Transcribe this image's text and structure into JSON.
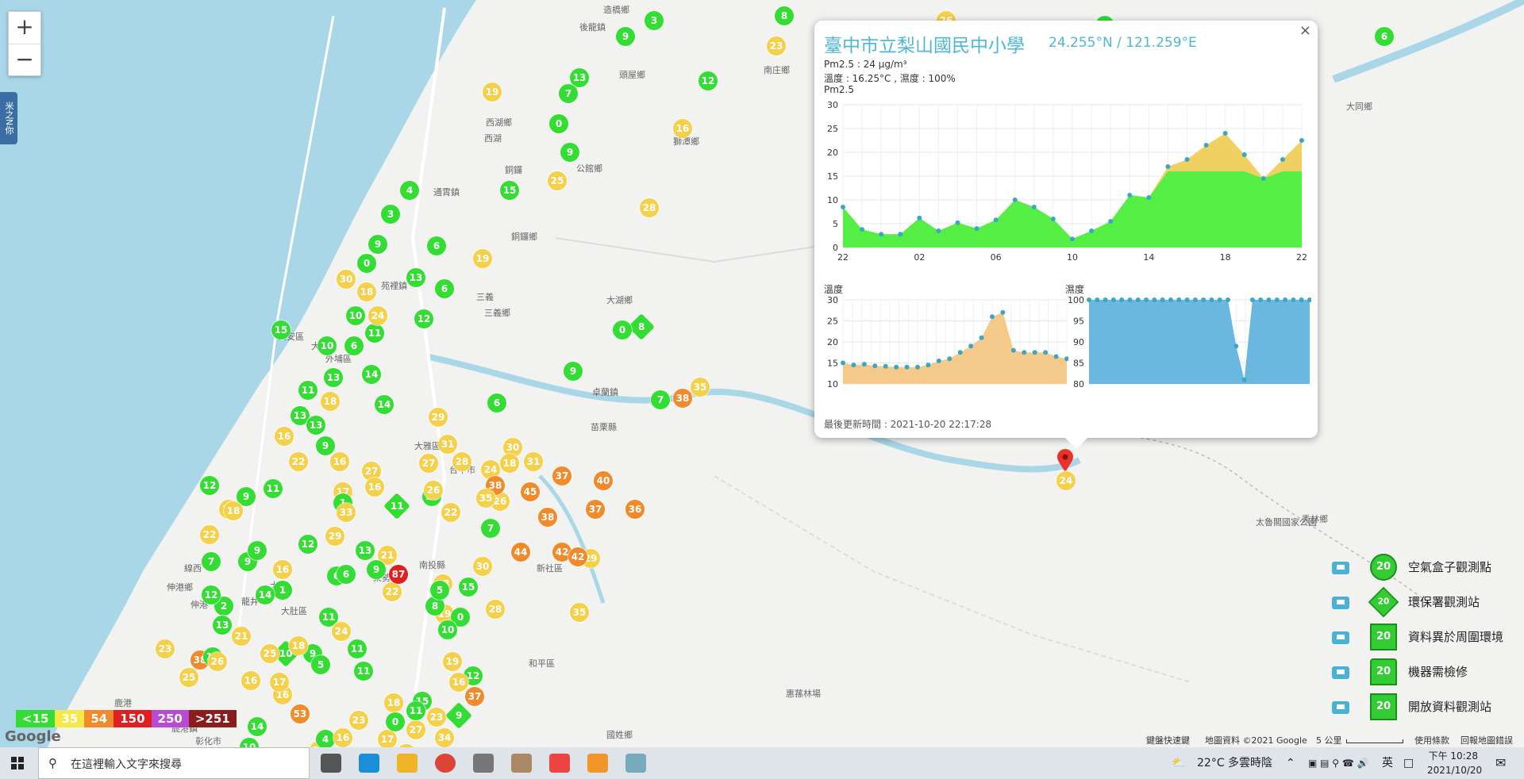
{
  "map": {
    "zoom_in": "+",
    "zoom_out": "−",
    "side_tab": "米之N你",
    "google_logo": "Google",
    "footer": {
      "shortcuts": "鍵盤快速鍵",
      "map_data": "地圖資料 ©2021 Google",
      "scale": "5 公里",
      "terms": "使用條款",
      "report": "回報地圖錯誤"
    },
    "place_labels": [
      "後龍鎮",
      "造橋鄉",
      "西湖鄉",
      "西湖",
      "頭屋鄉",
      "南庄鄉",
      "獅潭鄉",
      "公館鄉",
      "通霄鎮",
      "銅鑼",
      "銅鑼鄉",
      "苑裡鎮",
      "三義",
      "三義鄉",
      "大湖鄉",
      "大安區",
      "大甲區",
      "外埔區",
      "卓蘭鎮",
      "苗栗縣",
      "大同鄉",
      "大雅區",
      "台中市",
      "南投縣",
      "和平區",
      "伸港鄉",
      "線西",
      "伸港",
      "鹿港",
      "彰化市",
      "鹿港鎮",
      "秀林鄉",
      "太魯閣國家公園",
      "惠蓀林場",
      "國姓鄉",
      "新社區",
      "東勢",
      "大肚",
      "大肚區",
      "龍井"
    ],
    "markers": [
      {
        "v": "6",
        "c": "#33dd33"
      },
      {
        "v": "8",
        "c": "#33dd33"
      },
      {
        "v": "30",
        "c": "#f5d04a"
      },
      {
        "v": "14",
        "c": "#33dd33"
      },
      {
        "v": "12",
        "c": "#33dd33"
      },
      {
        "v": "6",
        "c": "#33dd33"
      },
      {
        "v": "23",
        "c": "#f5d04a"
      },
      {
        "v": "13",
        "c": "#33dd33"
      },
      {
        "v": "7",
        "c": "#33dd33"
      },
      {
        "v": "19",
        "c": "#f5d04a"
      },
      {
        "v": "12",
        "c": "#33dd33"
      },
      {
        "v": "0",
        "c": "#33dd33"
      },
      {
        "v": "16",
        "c": "#f5d04a"
      },
      {
        "v": "9",
        "c": "#33dd33"
      },
      {
        "v": "25",
        "c": "#f5d04a"
      },
      {
        "v": "15",
        "c": "#33dd33"
      },
      {
        "v": "28",
        "c": "#f5d04a"
      },
      {
        "v": "4",
        "c": "#33dd33"
      },
      {
        "v": "3",
        "c": "#33dd33"
      },
      {
        "v": "9",
        "c": "#33dd33"
      },
      {
        "v": "6",
        "c": "#33dd33"
      },
      {
        "v": "19",
        "c": "#f5d04a"
      },
      {
        "v": "0",
        "c": "#33dd33"
      },
      {
        "v": "13",
        "c": "#33dd33"
      },
      {
        "v": "6",
        "c": "#33dd33"
      },
      {
        "v": "30",
        "c": "#f5d04a"
      },
      {
        "v": "10",
        "c": "#33dd33"
      },
      {
        "v": "18",
        "c": "#f5d04a"
      },
      {
        "v": "11",
        "c": "#33dd33"
      },
      {
        "v": "24",
        "c": "#f5d04a"
      },
      {
        "v": "12",
        "c": "#33dd33"
      },
      {
        "v": "0",
        "c": "#33dd33"
      },
      {
        "v": "6",
        "c": "#33dd33"
      },
      {
        "v": "8",
        "c": "#33dd33",
        "d": true
      },
      {
        "v": "0",
        "c": "#33dd33"
      },
      {
        "v": "15",
        "c": "#33dd33"
      },
      {
        "v": "10",
        "c": "#33dd33"
      },
      {
        "v": "13",
        "c": "#33dd33"
      },
      {
        "v": "18",
        "c": "#f5d04a"
      },
      {
        "v": "14",
        "c": "#33dd33"
      },
      {
        "v": "11",
        "c": "#33dd33"
      },
      {
        "v": "6",
        "c": "#33dd33"
      },
      {
        "v": "14",
        "c": "#33dd33"
      },
      {
        "v": "35",
        "c": "#f5d04a"
      },
      {
        "v": "38",
        "c": "#f08a2a"
      },
      {
        "v": "7",
        "c": "#33dd33"
      },
      {
        "v": "9",
        "c": "#33dd33"
      },
      {
        "v": "7",
        "c": "#33dd33"
      },
      {
        "v": "13",
        "c": "#33dd33"
      },
      {
        "v": "16",
        "c": "#f5d04a"
      },
      {
        "v": "22",
        "c": "#f5d04a"
      },
      {
        "v": "27",
        "c": "#f5d04a"
      },
      {
        "v": "30",
        "c": "#f5d04a"
      },
      {
        "v": "26",
        "c": "#f5d04a"
      },
      {
        "v": "11",
        "c": "#33dd33"
      },
      {
        "v": "28",
        "c": "#f5d04a"
      },
      {
        "v": "29",
        "c": "#f5d04a"
      },
      {
        "v": "31",
        "c": "#f5d04a"
      },
      {
        "v": "24",
        "c": "#f5d04a"
      },
      {
        "v": "31",
        "c": "#f5d04a"
      },
      {
        "v": "37",
        "c": "#f08a2a"
      },
      {
        "v": "38",
        "c": "#f08a2a"
      },
      {
        "v": "37",
        "c": "#f08a2a"
      },
      {
        "v": "38",
        "c": "#f08a2a"
      },
      {
        "v": "45",
        "c": "#f08a2a"
      },
      {
        "v": "40",
        "c": "#f08a2a"
      },
      {
        "v": "36",
        "c": "#f08a2a"
      },
      {
        "v": "18",
        "c": "#f5d04a"
      },
      {
        "v": "42",
        "c": "#f08a2a"
      },
      {
        "v": "44",
        "c": "#f08a2a"
      },
      {
        "v": "29",
        "c": "#f5d04a"
      },
      {
        "v": "42",
        "c": "#f08a2a"
      },
      {
        "v": "30",
        "c": "#f5d04a"
      },
      {
        "v": "28",
        "c": "#f5d04a"
      },
      {
        "v": "35",
        "c": "#f5d04a"
      },
      {
        "v": "13",
        "c": "#33dd33"
      },
      {
        "v": "9",
        "c": "#33dd33"
      },
      {
        "v": "16",
        "c": "#f5d04a"
      },
      {
        "v": "17",
        "c": "#f5d04a"
      },
      {
        "v": "27",
        "c": "#f5d04a"
      },
      {
        "v": "16",
        "c": "#f5d04a"
      },
      {
        "v": "26",
        "c": "#f5d04a"
      },
      {
        "v": "11",
        "c": "#33dd33",
        "d": true
      },
      {
        "v": "35",
        "c": "#f5d04a"
      },
      {
        "v": "22",
        "c": "#f5d04a"
      },
      {
        "v": "12",
        "c": "#33dd33"
      },
      {
        "v": "11",
        "c": "#33dd33"
      },
      {
        "v": "9",
        "c": "#33dd33"
      },
      {
        "v": "16",
        "c": "#f5d04a"
      },
      {
        "v": "22",
        "c": "#f5d04a"
      },
      {
        "v": "7",
        "c": "#33dd33"
      },
      {
        "v": "9",
        "c": "#33dd33"
      },
      {
        "v": "18",
        "c": "#f5d04a"
      },
      {
        "v": "1",
        "c": "#33dd33"
      },
      {
        "v": "33",
        "c": "#f5d04a"
      },
      {
        "v": "29",
        "c": "#f5d04a"
      },
      {
        "v": "9",
        "c": "#33dd33"
      },
      {
        "v": "16",
        "c": "#f5d04a"
      },
      {
        "v": "1",
        "c": "#33dd33"
      },
      {
        "v": "2",
        "c": "#33dd33"
      },
      {
        "v": "14",
        "c": "#33dd33"
      },
      {
        "v": "13",
        "c": "#33dd33"
      },
      {
        "v": "21",
        "c": "#f5d04a"
      },
      {
        "v": "6",
        "c": "#33dd33"
      },
      {
        "v": "22",
        "c": "#f5d04a"
      },
      {
        "v": "9",
        "c": "#33dd33"
      },
      {
        "v": "87",
        "c": "#e02020"
      },
      {
        "v": "18",
        "c": "#f5d04a"
      },
      {
        "v": "19",
        "c": "#f5d04a"
      },
      {
        "v": "8",
        "c": "#33dd33"
      },
      {
        "v": "5",
        "c": "#33dd33"
      },
      {
        "v": "15",
        "c": "#33dd33"
      },
      {
        "v": "0",
        "c": "#33dd33"
      },
      {
        "v": "10",
        "c": "#33dd33"
      },
      {
        "v": "23",
        "c": "#f5d04a"
      },
      {
        "v": "38",
        "c": "#f08a2a"
      },
      {
        "v": "25",
        "c": "#f5d04a"
      },
      {
        "v": "12",
        "c": "#33dd33"
      },
      {
        "v": "16",
        "c": "#f5d04a"
      },
      {
        "v": "10",
        "c": "#33dd33",
        "d": true
      },
      {
        "v": "9",
        "c": "#33dd33"
      },
      {
        "v": "11",
        "c": "#33dd33"
      },
      {
        "v": "11",
        "c": "#33dd33"
      },
      {
        "v": "5",
        "c": "#33dd33"
      },
      {
        "v": "19",
        "c": "#f5d04a"
      },
      {
        "v": "12",
        "c": "#33dd33"
      },
      {
        "v": "15",
        "c": "#33dd33"
      },
      {
        "v": "18",
        "c": "#f5d04a"
      },
      {
        "v": "17",
        "c": "#f5d04a"
      },
      {
        "v": "24",
        "c": "#f5d04a"
      },
      {
        "v": "23",
        "c": "#f5d04a"
      },
      {
        "v": "34",
        "c": "#f5d04a"
      },
      {
        "v": "16",
        "c": "#f5d04a"
      },
      {
        "v": "37",
        "c": "#f08a2a"
      },
      {
        "v": "9",
        "c": "#33dd33",
        "d": true
      },
      {
        "v": "27",
        "c": "#f5d04a"
      },
      {
        "v": "0",
        "c": "#33dd33"
      },
      {
        "v": "11",
        "c": "#33dd33"
      },
      {
        "v": "26",
        "c": "#f5d04a"
      },
      {
        "v": "16",
        "c": "#f5d04a"
      },
      {
        "v": "53",
        "c": "#f08a2a"
      },
      {
        "v": "22",
        "c": "#f5d04a"
      },
      {
        "v": "4",
        "c": "#33dd33"
      },
      {
        "v": "16",
        "c": "#f5d04a"
      },
      {
        "v": "23",
        "c": "#f5d04a"
      },
      {
        "v": "10",
        "c": "#33dd33"
      },
      {
        "v": "14",
        "c": "#33dd33"
      },
      {
        "v": "17",
        "c": "#f5d04a"
      },
      {
        "v": "18",
        "c": "#f5d04a"
      },
      {
        "v": "11",
        "c": "#33dd33"
      },
      {
        "v": "24",
        "c": "#f5d04a"
      },
      {
        "v": "6",
        "c": "#33dd33"
      },
      {
        "v": "12",
        "c": "#33dd33"
      },
      {
        "v": "25",
        "c": "#f5d04a"
      },
      {
        "v": "21",
        "c": "#f5d04a"
      },
      {
        "v": "13",
        "c": "#33dd33"
      },
      {
        "v": "12",
        "c": "#33dd33"
      },
      {
        "v": "3",
        "c": "#33dd33"
      },
      {
        "v": "9",
        "c": "#33dd33"
      },
      {
        "v": "8",
        "c": "#33dd33"
      },
      {
        "v": "26",
        "c": "#f5d04a"
      },
      {
        "v": "15",
        "c": "#33dd33"
      }
    ]
  },
  "aqi_scale": [
    {
      "label": "<15",
      "color": "#33dd33"
    },
    {
      "label": "35",
      "color": "#f5e84a"
    },
    {
      "label": "54",
      "color": "#f08a2a"
    },
    {
      "label": "150",
      "color": "#e02020"
    },
    {
      "label": "250",
      "color": "#b94ad6"
    },
    {
      "label": ">251",
      "color": "#8a1c1c"
    }
  ],
  "selected_marker": {
    "value": "24",
    "color": "#f5d04a"
  },
  "popup": {
    "title": "臺中市立梨山國民中小學",
    "coords": "24.255°N / 121.259°E",
    "pm25_line": "Pm2.5 : 24 μg/m³",
    "temp_line": "溫度 : 16.25°C , 濕度 : 100%",
    "pm25_label": "Pm2.5",
    "temp_label": "溫度",
    "humidity_label": "濕度",
    "updated": "最後更新時間 : 2021-10-20 22:17:28",
    "close": "×"
  },
  "chart_data": [
    {
      "type": "area",
      "title": "Pm2.5",
      "x_ticks": [
        "22",
        "02",
        "06",
        "10",
        "14",
        "18",
        "22"
      ],
      "ylim": [
        0,
        30
      ],
      "y_ticks": [
        0,
        5,
        10,
        15,
        20,
        25,
        30
      ],
      "values": [
        8.5,
        3.8,
        2.8,
        2.8,
        6.2,
        3.5,
        5.2,
        4,
        5.8,
        10,
        8.5,
        6,
        1.8,
        3.5,
        5.5,
        11,
        10.5,
        17,
        18.5,
        21.5,
        24,
        19.5,
        14.5,
        18.5,
        22.5
      ],
      "threshold": 16,
      "colors": {
        "below": "#55ee44",
        "above": "#f0d060"
      },
      "grid": true
    },
    {
      "type": "area",
      "title": "溫度",
      "ylim": [
        10,
        30
      ],
      "y_ticks": [
        10,
        15,
        20,
        25,
        30
      ],
      "values": [
        15,
        14.5,
        14.7,
        14.3,
        14.2,
        14,
        14,
        14,
        14.5,
        15.5,
        16,
        17.5,
        19,
        21,
        26,
        27,
        18,
        17.5,
        17.5,
        17.5,
        16.5,
        16
      ],
      "colors": {
        "fill": "#f5c98a",
        "point": "#3aa8c4"
      },
      "grid": true
    },
    {
      "type": "area",
      "title": "濕度",
      "ylim": [
        80,
        100
      ],
      "y_ticks": [
        80,
        85,
        90,
        95,
        100
      ],
      "values": [
        100,
        100,
        100,
        100,
        100,
        100,
        100,
        100,
        100,
        100,
        100,
        100,
        100,
        100,
        100,
        100,
        100,
        100,
        89,
        81,
        100,
        100,
        100,
        100,
        100,
        100,
        100,
        100
      ],
      "colors": {
        "fill": "#6ab8e0",
        "point": "#3aa8c4"
      },
      "grid": true
    }
  ],
  "legend": [
    {
      "icon": "airbox-icon",
      "label": "空氣盒子觀測點",
      "badge": "20",
      "shape": "circle"
    },
    {
      "icon": "epa-building-icon",
      "label": "環保署觀測站",
      "badge": "20",
      "shape": "diamond"
    },
    {
      "icon": "house-icon",
      "label": "資料異於周圍環境",
      "badge": "20",
      "shape": "square"
    },
    {
      "icon": "cone-icon",
      "label": "機器需檢修",
      "badge": "20",
      "shape": "triangle"
    },
    {
      "icon": "open-data-icon",
      "label": "開放資料觀測站",
      "badge": "20",
      "shape": "square"
    }
  ],
  "taskbar": {
    "search_placeholder": "在這裡輸入文字來搜尋",
    "weather": "22°C 多雲時陰",
    "ime": "英",
    "time": "下午 10:28",
    "date": "2021/10/20",
    "apps": [
      "task-view-icon",
      "edge-icon",
      "file-explorer-icon",
      "chrome-icon",
      "compass-app-icon",
      "snip-icon",
      "paint-icon",
      "blender-icon",
      "notepad-icon"
    ]
  }
}
